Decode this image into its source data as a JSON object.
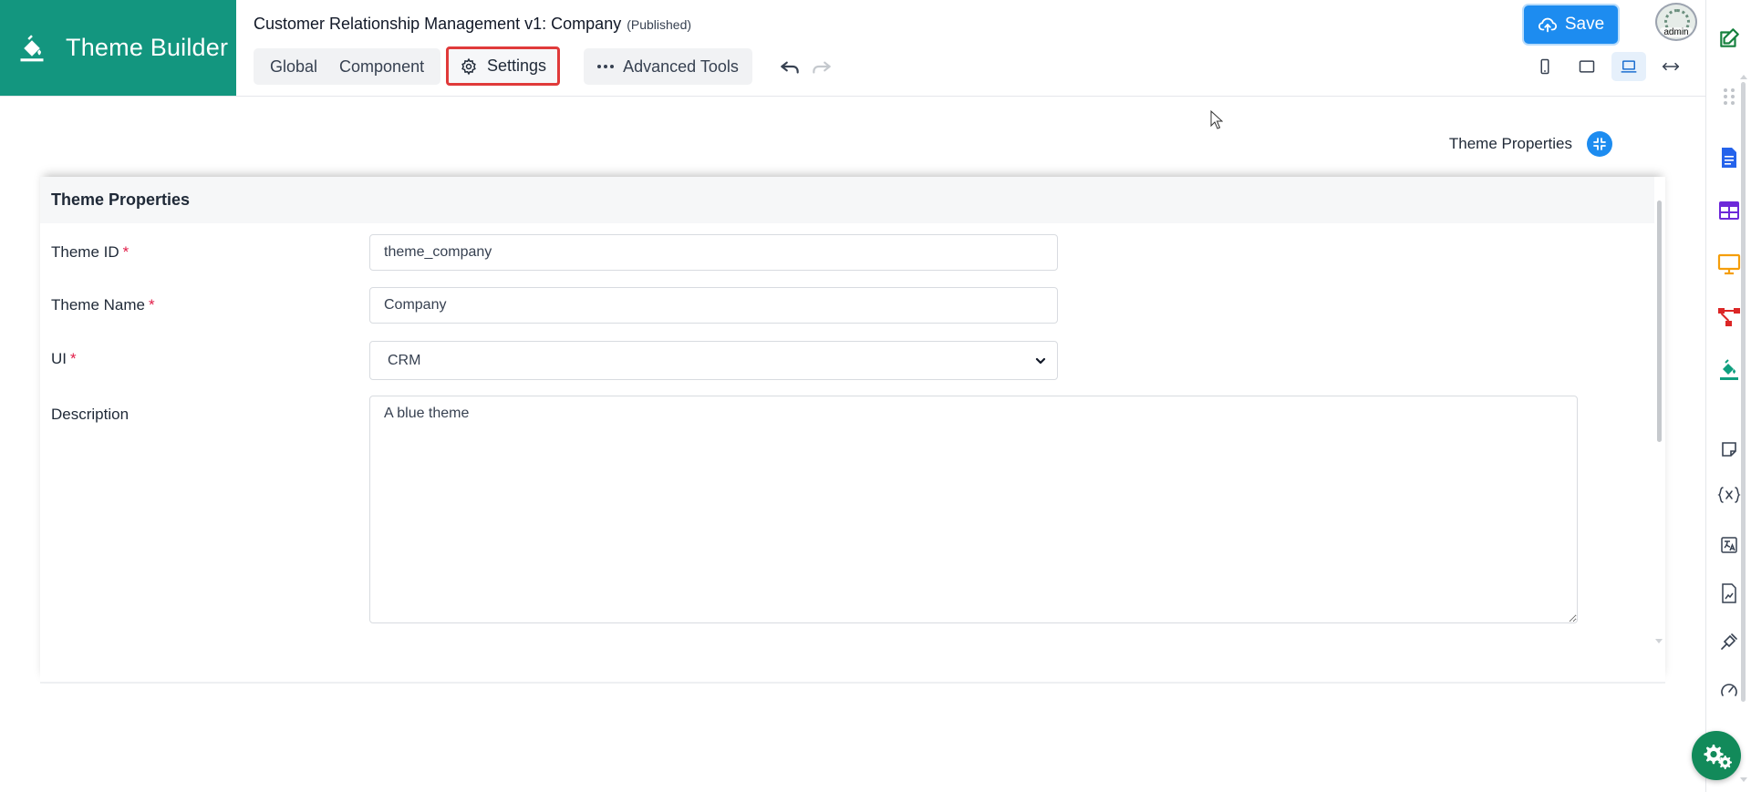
{
  "brand": {
    "title": "Theme Builder",
    "icon": "paint-bucket-icon",
    "color": "#13967f"
  },
  "header": {
    "app_title": "Customer Relationship Management v1: Company",
    "app_status": "(Published)",
    "tabs": [
      {
        "label": "Global"
      },
      {
        "label": "Component"
      }
    ],
    "settings_label": "Settings",
    "advanced_tools_label": "Advanced Tools",
    "save_label": "Save",
    "avatar_label": "admin",
    "accent_color": "#1d8cf0",
    "highlight_color": "#e03a3a",
    "devices": [
      "mobile-icon",
      "tablet-icon",
      "laptop-icon",
      "full-width-icon"
    ],
    "active_device": "laptop-icon"
  },
  "panel": {
    "header_label": "Theme Properties",
    "card_title": "Theme Properties",
    "fields": {
      "theme_id": {
        "label": "Theme ID",
        "required": "*",
        "value": "theme_company"
      },
      "theme_name": {
        "label": "Theme Name",
        "required": "*",
        "value": "Company"
      },
      "ui": {
        "label": "UI",
        "required": "*",
        "value": "CRM"
      },
      "description": {
        "label": "Description",
        "value": "A blue theme"
      }
    }
  },
  "rail": {
    "items": [
      "edit-icon",
      "drag-handle-icon",
      "document-icon",
      "table-icon",
      "monitor-icon",
      "flow-icon",
      "paint-bucket-icon",
      "note-icon",
      "variable-icon",
      "translate-icon",
      "file-chart-icon",
      "plugin-icon",
      "gauge-icon"
    ]
  },
  "fab": {
    "icon": "gears-icon",
    "color": "#128a5a"
  }
}
